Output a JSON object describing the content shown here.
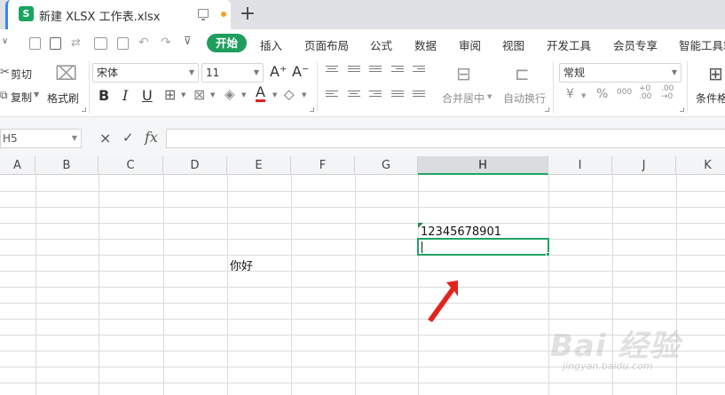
{
  "titlebar": {
    "app_logo": "S",
    "document_title": "新建 XLSX 工作表.xlsx",
    "new_tab_label": "+"
  },
  "menubar": {
    "tabs": [
      {
        "label": "开始",
        "active": true
      },
      {
        "label": "插入"
      },
      {
        "label": "页面布局"
      },
      {
        "label": "公式"
      },
      {
        "label": "数据"
      },
      {
        "label": "审阅"
      },
      {
        "label": "视图"
      },
      {
        "label": "开发工具"
      },
      {
        "label": "会员专享"
      },
      {
        "label": "智能工具箱"
      }
    ]
  },
  "ribbon": {
    "cut_label": "剪切",
    "copy_label": "复制",
    "format_painter_label": "格式刷",
    "font_name": "宋体",
    "font_size": "11",
    "bold_label": "B",
    "italic_label": "I",
    "underline_label": "U",
    "font_color_label": "A",
    "merge_center_label": "合并居中",
    "wrap_text_label": "自动换行",
    "number_format": "常规",
    "currency_label": "¥",
    "percent_label": "%",
    "thousands_label": "000",
    "conditional_format_label": "条件格式",
    "font_size_increase": "A⁺",
    "font_size_decrease": "A⁻"
  },
  "formula_bar": {
    "name_box": "H5",
    "cancel_icon": "×",
    "confirm_icon": "✓",
    "function_label": "fx",
    "formula_value": ""
  },
  "sheet": {
    "columns": [
      "A",
      "B",
      "C",
      "D",
      "E",
      "F",
      "G",
      "H",
      "I",
      "J",
      "K"
    ],
    "active_column": "H",
    "cells": {
      "E6": "你好",
      "H4": "12345678901"
    },
    "active_cell": "H5"
  },
  "watermark": {
    "main": "Bai 经验",
    "sub": "jingyan.baidu.com"
  },
  "colors": {
    "accent_green": "#1f9e5e",
    "selection_green": "#21a366",
    "annotation_red": "#e5231d"
  }
}
